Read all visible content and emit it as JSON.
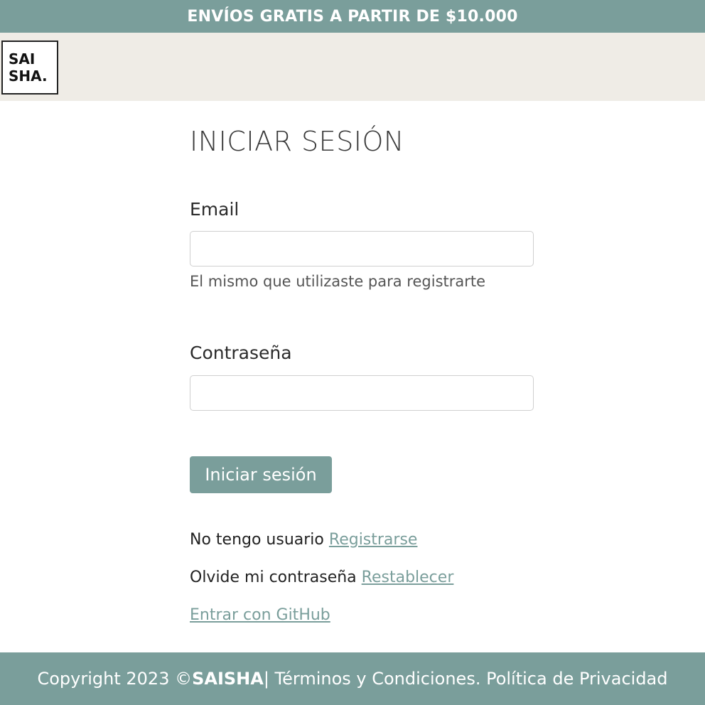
{
  "promo": {
    "text": "ENVÍOS GRATIS A PARTIR DE $10.000"
  },
  "header": {
    "logo_line1": "SAI",
    "logo_line2": "SHA."
  },
  "login": {
    "title": "INICIAR SESIÓN",
    "email_label": "Email",
    "email_value": "",
    "email_help": "El mismo que utilizaste para registrarte",
    "password_label": "Contraseña",
    "password_value": "",
    "submit_label": "Iniciar sesión",
    "register_text": "No tengo usuario",
    "register_link": "Registrarse",
    "reset_text": "Olvide mi contraseña",
    "reset_link": "Restablecer",
    "github_link": "Entrar con GitHub"
  },
  "footer": {
    "prefix": "Copyright 2023 © ",
    "brand": "SAISHA",
    "suffix": " | Términos y Condiciones. Política de Privacidad"
  },
  "colors": {
    "accent": "#7a9e9b",
    "header_bg": "#efece6"
  }
}
